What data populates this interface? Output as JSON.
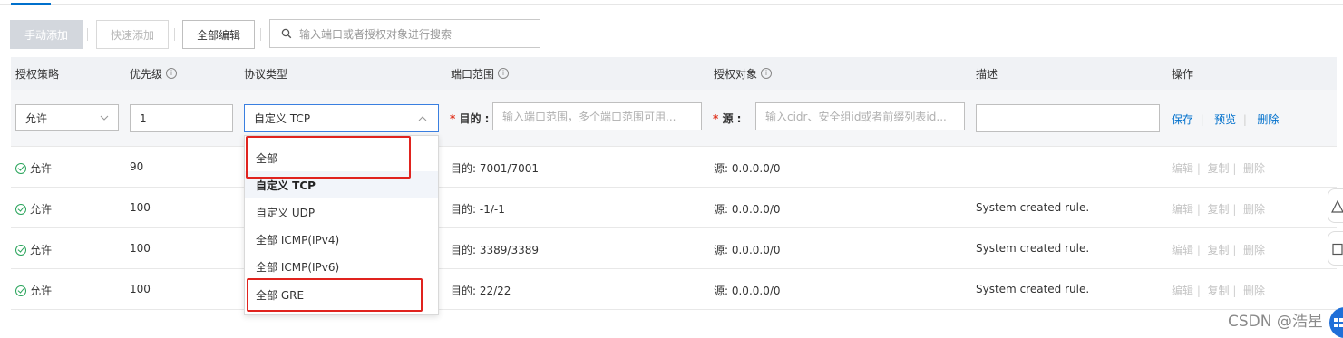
{
  "toolbar": {
    "manual_add": "手动添加",
    "quick_add": "快速添加",
    "edit_all": "全部编辑",
    "search_placeholder": "输入端口或者授权对象进行搜索"
  },
  "columns": {
    "policy": "授权策略",
    "priority": "优先级",
    "protocol": "协议类型",
    "port_range": "端口范围",
    "auth_object": "授权对象",
    "description": "描述",
    "actions": "操作"
  },
  "edit_row": {
    "policy": "允许",
    "priority": "1",
    "protocol": "自定义 TCP",
    "dest_label": "目的 :",
    "dest_placeholder": "输入端口范围，多个端口范围可用...",
    "src_label": "源 :",
    "src_placeholder": "输入cidr、安全组id或者前缀列表id...",
    "save": "保存",
    "preview": "预览",
    "delete": "删除"
  },
  "rows": [
    {
      "policy": "允许",
      "priority": "90",
      "port": "目的: 7001/7001",
      "source": "源: 0.0.0.0/0",
      "description": ""
    },
    {
      "policy": "允许",
      "priority": "100",
      "port": "目的: -1/-1",
      "source": "源: 0.0.0.0/0",
      "description": "System created rule."
    },
    {
      "policy": "允许",
      "priority": "100",
      "port": "目的: 3389/3389",
      "source": "源: 0.0.0.0/0",
      "description": "System created rule."
    },
    {
      "policy": "允许",
      "priority": "100",
      "port": "目的: 22/22",
      "source": "源: 0.0.0.0/0",
      "description": "System created rule."
    }
  ],
  "row_actions": {
    "edit": "编辑",
    "copy": "复制",
    "delete": "删除"
  },
  "protocol_options": [
    "全部",
    "自定义 TCP",
    "自定义 UDP",
    "全部 ICMP(IPv4)",
    "全部 ICMP(IPv6)",
    "全部 GRE"
  ],
  "selected_protocol": "自定义 TCP",
  "watermark": "CSDN @浩星",
  "colors": {
    "link": "#0070cc",
    "highlight_box": "#e0231e",
    "allow_icon": "#2aa45b"
  }
}
